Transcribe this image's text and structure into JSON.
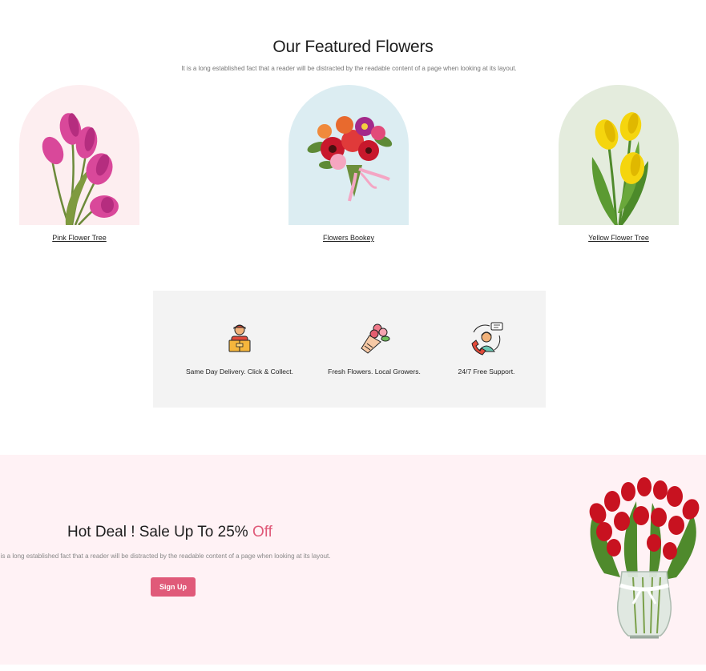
{
  "featured": {
    "title": "Our Featured Flowers",
    "subtitle": "It is a long established fact that a reader will be distracted by the readable content of a page when looking at its layout.",
    "cards": [
      {
        "label": "Pink Flower Tree",
        "bg": "#fdeef0"
      },
      {
        "label": "Flowers Bookey",
        "bg": "#dcedf2"
      },
      {
        "label": "Yellow Flower Tree",
        "bg": "#e4ecdd"
      }
    ]
  },
  "features": [
    {
      "text": "Same Day Delivery. Click & Collect.",
      "icon": "delivery-man-icon"
    },
    {
      "text": "Fresh Flowers. Local Growers.",
      "icon": "bouquet-icon"
    },
    {
      "text": "24/7 Free Support.",
      "icon": "support-agent-icon"
    }
  ],
  "deal": {
    "title": "Hot Deal ! Sale Up To 25%",
    "accent": "Off",
    "subtitle": "It is a long established fact that a reader will be distracted by the readable content of a page when looking at its layout.",
    "button": "Sign Up"
  },
  "colors": {
    "accent": "#e05a79",
    "deal_bg": "#fff2f5",
    "features_bg": "#f3f3f3"
  }
}
